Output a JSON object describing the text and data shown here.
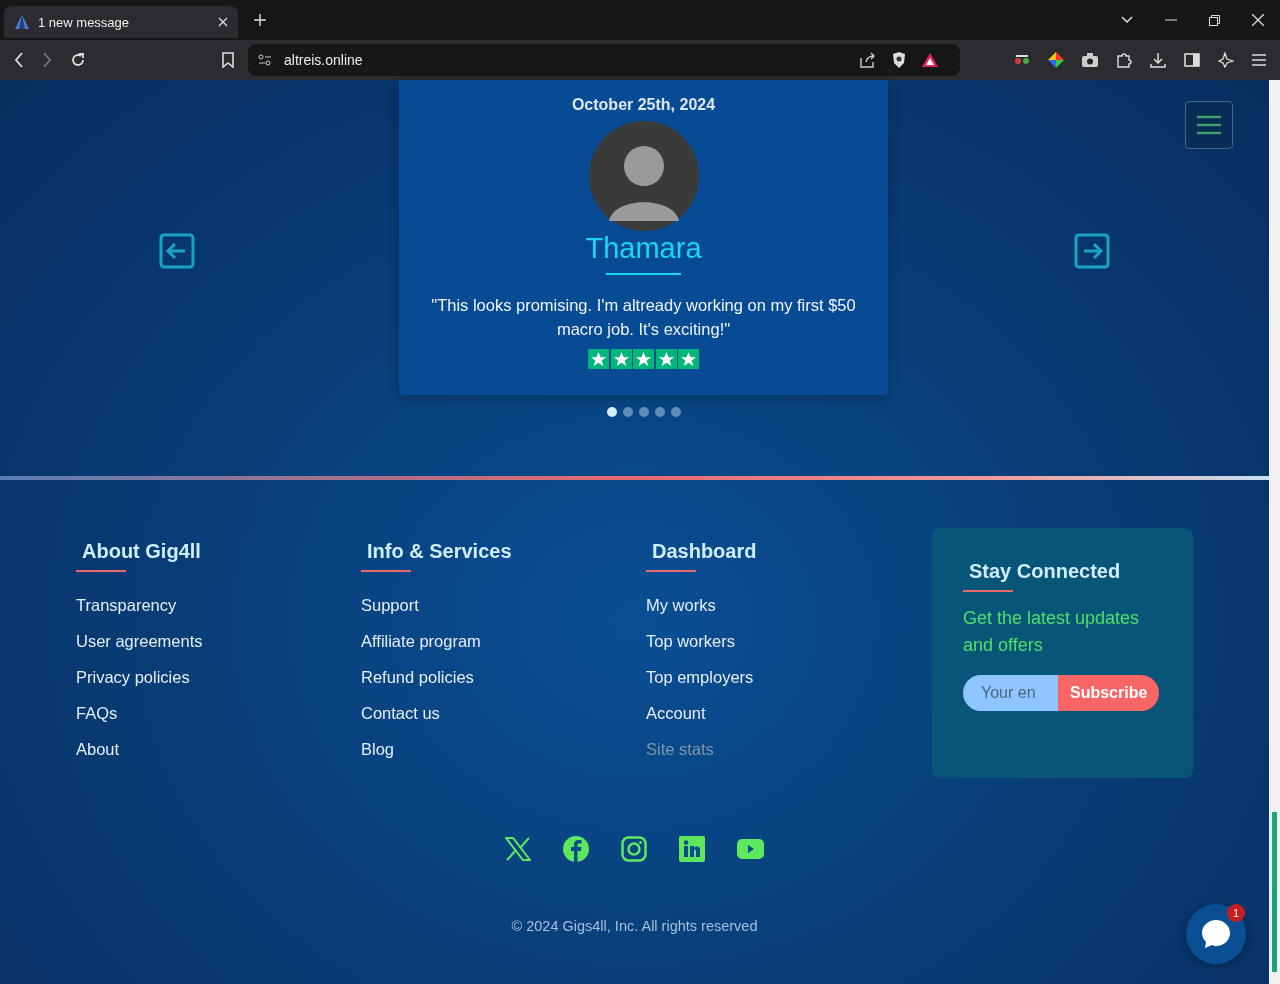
{
  "browser": {
    "tab_title": "1 new message",
    "url": "altreis.online"
  },
  "testimonial": {
    "date": "October 25th, 2024",
    "name": "Thamara",
    "quote": "\"This looks promising. I'm altready working on my first $50 macro job. It's exciting!\"",
    "stars": 5,
    "dots": [
      {
        "selected": true
      },
      {
        "selected": false
      },
      {
        "selected": false
      },
      {
        "selected": false
      },
      {
        "selected": false
      }
    ]
  },
  "footer": {
    "columns": [
      {
        "title": "About Gig4ll",
        "links": [
          {
            "label": "Transparency",
            "disabled": false
          },
          {
            "label": "User agreements",
            "disabled": false
          },
          {
            "label": "Privacy policies",
            "disabled": false
          },
          {
            "label": "FAQs",
            "disabled": false
          },
          {
            "label": "About",
            "disabled": false
          }
        ]
      },
      {
        "title": "Info & Services",
        "links": [
          {
            "label": "Support",
            "disabled": false
          },
          {
            "label": "Affiliate program",
            "disabled": false
          },
          {
            "label": "Refund policies",
            "disabled": false
          },
          {
            "label": "Contact us",
            "disabled": false
          },
          {
            "label": "Blog",
            "disabled": false
          }
        ]
      },
      {
        "title": "Dashboard",
        "links": [
          {
            "label": "My works",
            "disabled": false
          },
          {
            "label": "Top workers",
            "disabled": false
          },
          {
            "label": "Top employers",
            "disabled": false
          },
          {
            "label": "Account",
            "disabled": false
          },
          {
            "label": "Site stats",
            "disabled": true
          }
        ]
      }
    ],
    "newsletter": {
      "title": "Stay Connected",
      "text": "Get the latest updates and offers",
      "placeholder": "Your en",
      "button": "Subscribe"
    },
    "social": [
      {
        "kind": "x"
      },
      {
        "kind": "facebook"
      },
      {
        "kind": "instagram"
      },
      {
        "kind": "linkedin"
      },
      {
        "kind": "youtube"
      }
    ],
    "copyright": "© 2024 Gigs4ll, Inc. All rights reserved"
  },
  "chat": {
    "badge": "1"
  }
}
